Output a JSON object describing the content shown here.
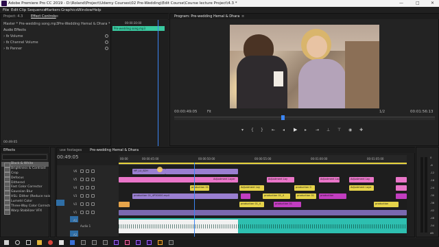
{
  "window": {
    "title": "Adobe Premiere Pro CC 2019 - D:\\Roland\\Project\\Udemy Courses\\02 Pre-Wedding\\Edit Course\\Course lecture Project\\4.3 *",
    "minimize": "—",
    "maximize": "□",
    "close": "✕"
  },
  "menu": [
    "File",
    "Edit",
    "Clip",
    "Sequence",
    "Markers",
    "Graphics",
    "Window",
    "Help"
  ],
  "effect_controls": {
    "tabs": [
      "Project: 4.3",
      "Effect Controls",
      "≡"
    ],
    "source_label": "Master * Pre-wedding song.mp3",
    "seq_label": "Pre-Wedding Hemal & Dhara * Pre-wedding song.mp3",
    "section": "Audio Effects",
    "effects": [
      "Volume",
      "Channel Volume",
      "Panner"
    ],
    "mini_timecode": "00:00:30:00",
    "mini_clip": "Pre-wedding song.mp3",
    "timecode": "00:49:05"
  },
  "program": {
    "title": "Program: Pre-wedding Hemal & Dhara",
    "menu": "≡",
    "timecode": "00:00:49:05",
    "fit": "Fit",
    "quality": "1/2",
    "duration": "00:01:56:13"
  },
  "effects_panel": {
    "title": "Effects",
    "items": [
      "Black & White",
      "Brightness & Contrast",
      "Crop",
      "Defocus",
      "Dithered",
      "Fast Color Corrector",
      "Gaussian Blur",
      "HSL: Dither (Reduce noise)",
      "Lumetri Color",
      "Three-Way Color Corrector",
      "Warp Stabilizer VFX"
    ],
    "selected": 0
  },
  "timeline": {
    "tabs": [
      "use footages",
      "Pre-wedding Hemal & Dhara"
    ],
    "timecode": "00:49:05",
    "ruler": [
      "00:00",
      "00:00:45:00",
      "00:00:50:00",
      "00:00:55:00",
      "00:01:00:00",
      "00:01:05:00"
    ],
    "track_labels": [
      "V6",
      "V5",
      "V4",
      "V3",
      "V2",
      "V1",
      "A1",
      "A2"
    ],
    "audio_name": "Audio 1",
    "clips": {
      "v6": "MP_LU_B2H",
      "adj_long": "Adjustment Layer",
      "prod1": "production 01",
      "prod_v3": "production 01_4P30000.mp4",
      "adj1": "Adjustment Lay",
      "adj2": "Adjustment Lay",
      "adj3": "Adjustment Lay",
      "adj4": "Adjustment Lay",
      "adj5": "Adjustment Laye",
      "prod_a": "production 0",
      "prod_b": "production 01_4",
      "prod_c": "production 01",
      "prod_d": "production",
      "prod_e": "production 01_4",
      "prod_f": "production 01",
      "prod_g": "production"
    },
    "meter_ticks": [
      "0",
      "-6",
      "-12",
      "-18",
      "-24",
      "-30",
      "-36",
      "-42",
      "-48",
      "-54",
      "dB"
    ]
  },
  "colors": {
    "accent": "#2d8ceb",
    "audio_clip": "#2ebfb0",
    "video_clip": "#9a7fd1",
    "adjustment": "#e975c8",
    "yellow_clip": "#e5d34a",
    "playhead": "#3b86f5"
  }
}
